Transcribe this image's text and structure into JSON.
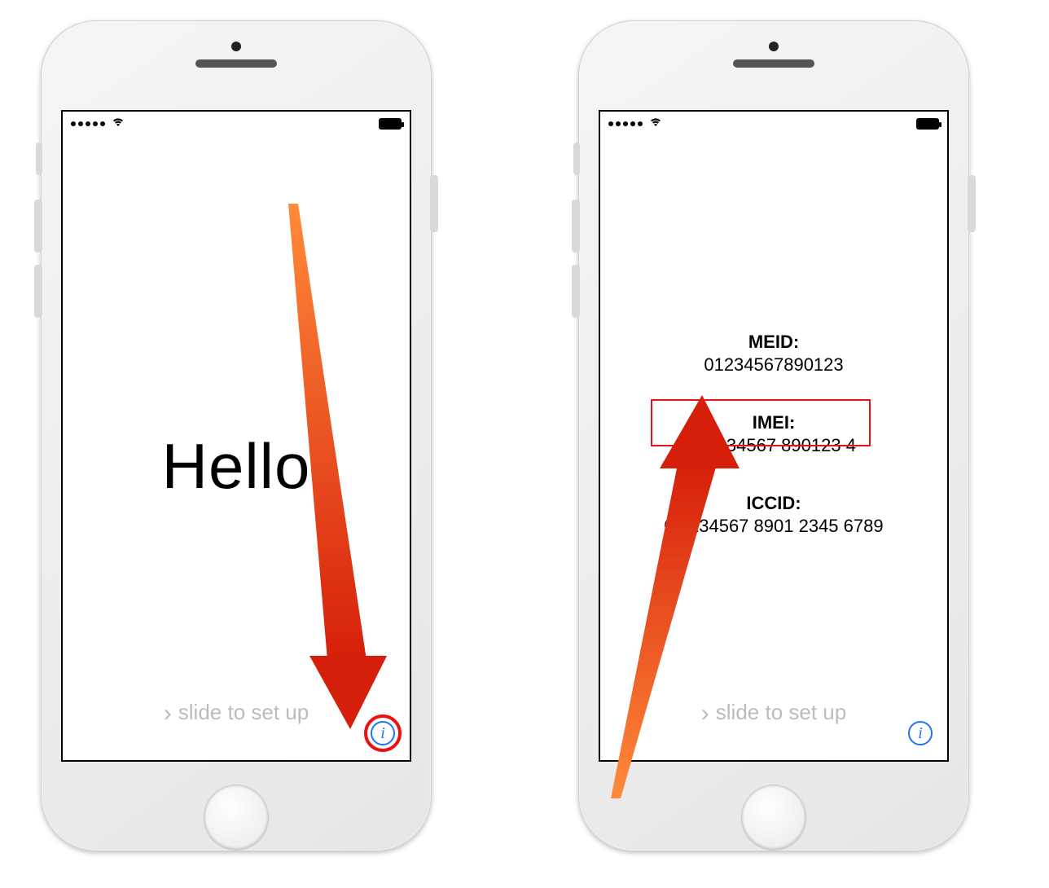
{
  "left_screen": {
    "greeting": "Hello",
    "slide_text": "slide to set up"
  },
  "right_screen": {
    "meid_label": "MEID:",
    "meid_value": "01234567890123",
    "imei_label": "IMEI:",
    "imei_value": "01 234567 890123 4",
    "iccid_label": "ICCID:",
    "iccid_value": "01 234567 8901 2345 6789",
    "slide_text": "slide to set up"
  }
}
